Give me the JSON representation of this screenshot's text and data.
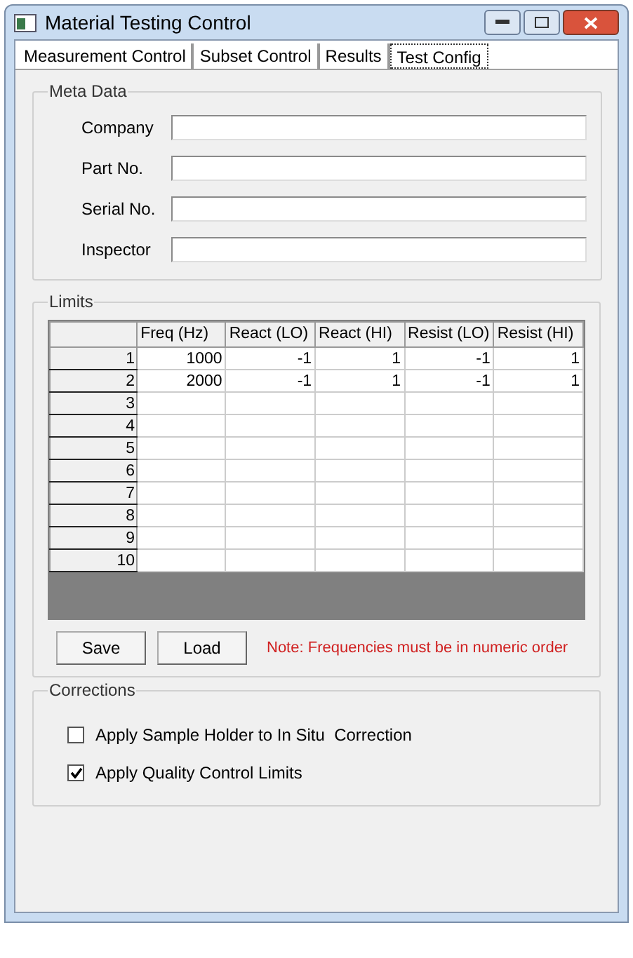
{
  "window": {
    "title": "Material Testing Control"
  },
  "tabs": [
    {
      "label": "Measurement Control",
      "selected": false
    },
    {
      "label": "Subset Control",
      "selected": false
    },
    {
      "label": "Results",
      "selected": false
    },
    {
      "label": "Test Config",
      "selected": true
    }
  ],
  "meta_data": {
    "title": "Meta Data",
    "fields": [
      {
        "label": "Company"
      },
      {
        "label": "Part No."
      },
      {
        "label": "Serial No."
      },
      {
        "label": "Inspector"
      }
    ]
  },
  "limits": {
    "title": "Limits",
    "columns": [
      "Freq (Hz)",
      "React (LO)",
      "React (HI)",
      "Resist (LO)",
      "Resist (HI)"
    ],
    "rows": [
      {
        "number": "1",
        "cells": [
          "1000",
          "-1",
          "1",
          "-1",
          "1"
        ]
      },
      {
        "number": "2",
        "cells": [
          "2000",
          "-1",
          "1",
          "-1",
          "1"
        ]
      },
      {
        "number": "3"
      },
      {
        "number": "4"
      },
      {
        "number": "5"
      },
      {
        "number": "6"
      },
      {
        "number": "7"
      },
      {
        "number": "8"
      },
      {
        "number": "9"
      },
      {
        "number": "10"
      }
    ],
    "buttons": [
      "Save",
      "Load"
    ],
    "note": "Note: Frequencies must be in numeric order"
  },
  "corrections": {
    "title": "Corrections",
    "options": [
      {
        "label": "Apply Sample Holder to In Situ  Correction",
        "checked": false
      },
      {
        "label": "Apply Quality Control Limits",
        "checked": true
      }
    ]
  }
}
